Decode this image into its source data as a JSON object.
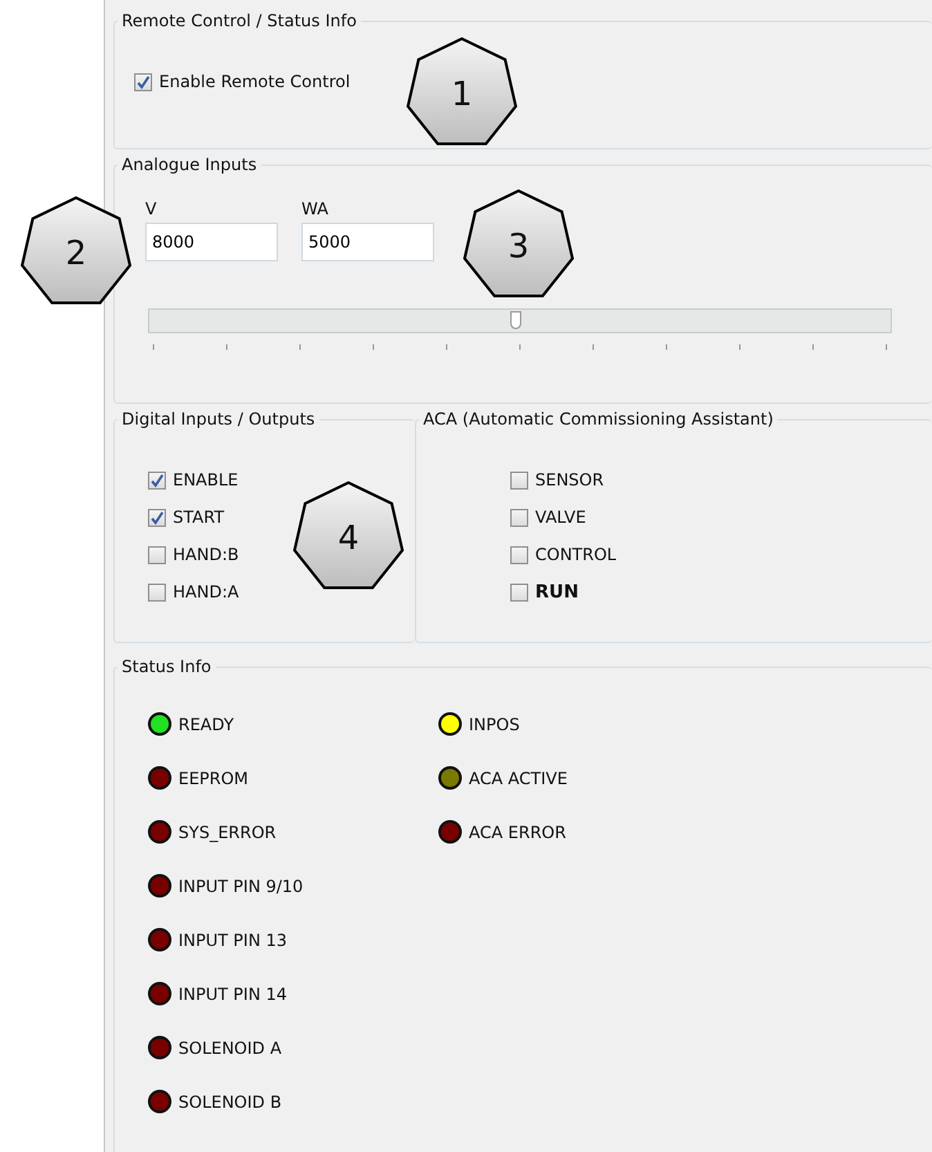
{
  "remote": {
    "title": "Remote Control / Status Info",
    "checkbox": {
      "label": "Enable Remote Control",
      "checked": true
    }
  },
  "analogue": {
    "title": "Analogue Inputs",
    "fields": [
      {
        "label": "V",
        "value": "8000"
      },
      {
        "label": "WA",
        "value": "5000"
      }
    ],
    "slider": {
      "level": 0.5
    }
  },
  "digital": {
    "title": "Digital Inputs / Outputs",
    "items": [
      {
        "label": "ENABLE",
        "checked": true
      },
      {
        "label": "START",
        "checked": true
      },
      {
        "label": "HAND:B",
        "checked": false
      },
      {
        "label": "HAND:A",
        "checked": false
      }
    ]
  },
  "aca": {
    "title": "ACA (Automatic Commissioning Assistant)",
    "items": [
      {
        "label": "SENSOR",
        "checked": false,
        "bold": false
      },
      {
        "label": "VALVE",
        "checked": false,
        "bold": false
      },
      {
        "label": "CONTROL",
        "checked": false,
        "bold": false
      },
      {
        "label": "RUN",
        "checked": false,
        "bold": true
      }
    ]
  },
  "status": {
    "title": "Status Info",
    "columns": [
      [
        {
          "label": "READY",
          "color": "#22e022"
        },
        {
          "label": "EEPROM",
          "color": "#7a0000"
        },
        {
          "label": "SYS_ERROR",
          "color": "#7a0000"
        },
        {
          "label": "INPUT PIN 9/10",
          "color": "#7a0000"
        },
        {
          "label": "INPUT PIN 13",
          "color": "#7a0000"
        },
        {
          "label": "INPUT PIN 14",
          "color": "#7a0000"
        },
        {
          "label": "SOLENOID A",
          "color": "#7a0000"
        },
        {
          "label": "SOLENOID B",
          "color": "#7a0000"
        }
      ],
      [
        {
          "label": "INPOS",
          "color": "#ffff00"
        },
        {
          "label": "ACA ACTIVE",
          "color": "#7a7a00"
        },
        {
          "label": "ACA ERROR",
          "color": "#7a0000"
        }
      ]
    ]
  },
  "callouts": [
    "1",
    "2",
    "3",
    "4"
  ]
}
